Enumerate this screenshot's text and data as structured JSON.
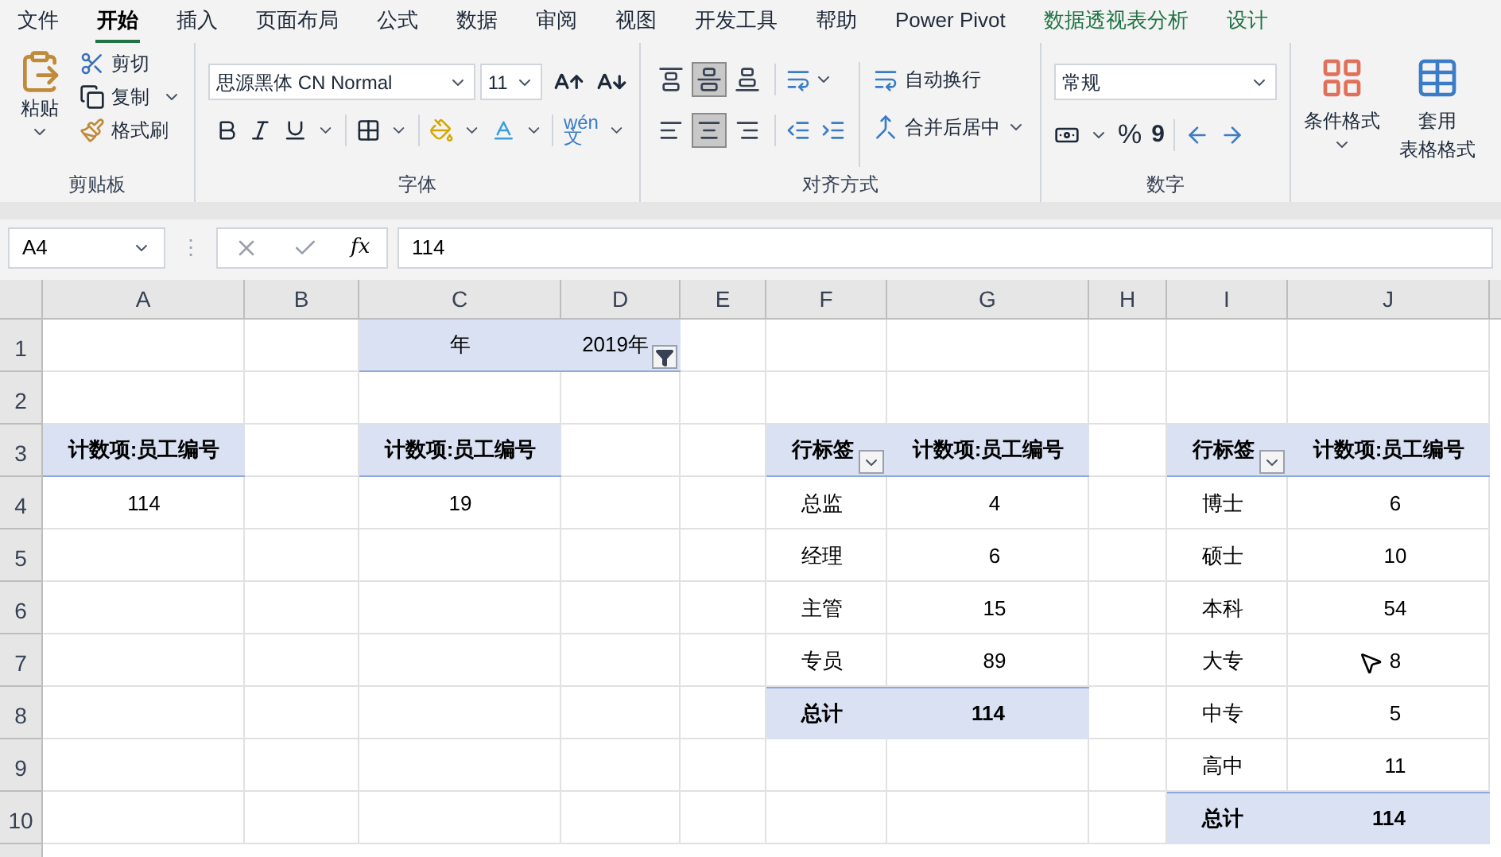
{
  "ribbon_tabs": [
    {
      "label": "文件",
      "selected": false,
      "kind": "normal"
    },
    {
      "label": "开始",
      "selected": true,
      "kind": "normal"
    },
    {
      "label": "插入",
      "selected": false,
      "kind": "normal"
    },
    {
      "label": "页面布局",
      "selected": false,
      "kind": "normal"
    },
    {
      "label": "公式",
      "selected": false,
      "kind": "normal"
    },
    {
      "label": "数据",
      "selected": false,
      "kind": "normal"
    },
    {
      "label": "审阅",
      "selected": false,
      "kind": "normal"
    },
    {
      "label": "视图",
      "selected": false,
      "kind": "normal"
    },
    {
      "label": "开发工具",
      "selected": false,
      "kind": "normal"
    },
    {
      "label": "帮助",
      "selected": false,
      "kind": "normal"
    },
    {
      "label": "Power Pivot",
      "selected": false,
      "kind": "normal"
    },
    {
      "label": "数据透视表分析",
      "selected": false,
      "kind": "contextual"
    },
    {
      "label": "设计",
      "selected": false,
      "kind": "contextual"
    }
  ],
  "clipboard": {
    "paste": "粘贴",
    "cut": "剪切",
    "copy": "复制",
    "format_painter": "格式刷",
    "group": "剪贴板"
  },
  "font": {
    "name": "思源黑体 CN Normal",
    "size": "11",
    "phonetic": "wén",
    "phonetic_char": "文",
    "group": "字体"
  },
  "alignment": {
    "buttons": [
      {
        "kind": "top",
        "pressed": false
      },
      {
        "kind": "middle",
        "pressed": true
      },
      {
        "kind": "bottom",
        "pressed": false
      },
      {
        "kind": "left",
        "pressed": false
      },
      {
        "kind": "center",
        "pressed": true
      },
      {
        "kind": "right",
        "pressed": false
      }
    ],
    "wrap": "自动换行",
    "merge": "合并后居中",
    "group": "对齐方式"
  },
  "number": {
    "format": "常规",
    "percent": "%",
    "comma": "9",
    "group": "数字"
  },
  "styles": {
    "conditional": "条件格式",
    "table_format": [
      "套用",
      "表格格式"
    ]
  },
  "formula_bar": {
    "name_box": "A4",
    "separator": "⋮",
    "fx": "fx",
    "value": "114"
  },
  "sheet": {
    "columns": [
      "A",
      "B",
      "C",
      "D",
      "E",
      "F",
      "G",
      "H",
      "I",
      "J"
    ],
    "rows": [
      "1",
      "2",
      "3",
      "4",
      "5",
      "6",
      "7",
      "8",
      "9",
      "10"
    ]
  },
  "year_filter": {
    "label": "年",
    "value": "2019年"
  },
  "pivot_total": {
    "header": "计数项:员工编号",
    "value": "114"
  },
  "pivot_filtered": {
    "header": "计数项:员工编号",
    "value": "19"
  },
  "pivot_position": {
    "row_header": "行标签",
    "value_header": "计数项:员工编号",
    "rows": [
      {
        "label": "总监",
        "value": "4"
      },
      {
        "label": "经理",
        "value": "6"
      },
      {
        "label": "主管",
        "value": "15"
      },
      {
        "label": "专员",
        "value": "89"
      }
    ],
    "total": {
      "label": "总计",
      "value": "114"
    }
  },
  "pivot_education": {
    "row_header": "行标签",
    "value_header": "计数项:员工编号",
    "rows": [
      {
        "label": "博士",
        "value": "6"
      },
      {
        "label": "硕士",
        "value": "10"
      },
      {
        "label": "本科",
        "value": "54"
      },
      {
        "label": "大专",
        "value": "8",
        "pointer": true
      },
      {
        "label": "中专",
        "value": "5"
      },
      {
        "label": "高中",
        "value": "11"
      }
    ],
    "total": {
      "label": "总计",
      "value": "114"
    }
  }
}
